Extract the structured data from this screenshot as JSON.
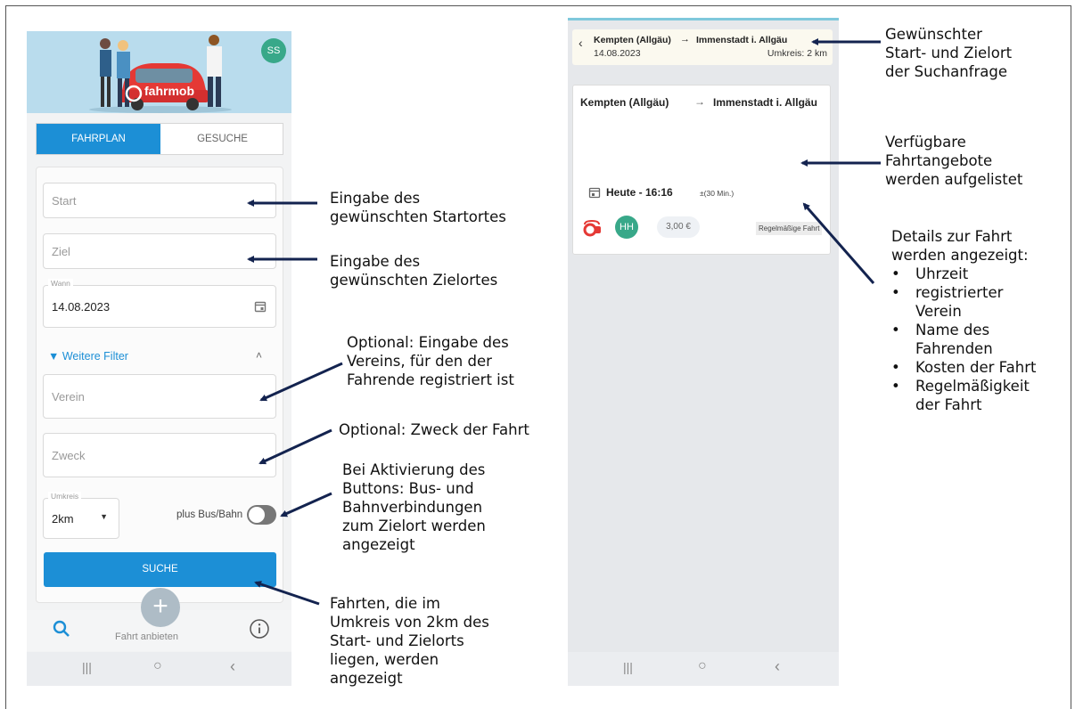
{
  "left_phone": {
    "avatar": "SS",
    "logo": "fahrmob",
    "tabs": {
      "fahrplan": "FAHRPLAN",
      "gesuche": "GESUCHE"
    },
    "form": {
      "start_placeholder": "Start",
      "ziel_placeholder": "Ziel",
      "wann_label": "Wann",
      "wann_value": "14.08.2023",
      "filter_label": "Weitere Filter",
      "verein_placeholder": "Verein",
      "zweck_placeholder": "Zweck",
      "umkreis_label": "Umkreis",
      "umkreis_value": "2km",
      "bus_bahn_label": "plus Bus/Bahn",
      "search_button": "SUCHE"
    },
    "bottom_nav": {
      "offer_label": "Fahrt anbieten"
    }
  },
  "right_phone": {
    "header": {
      "from": "Kempten (Allgäu)",
      "arrow": "→",
      "to": "Immenstadt i. Allgäu",
      "date": "14.08.2023",
      "radius": "Umkreis: 2 km"
    },
    "result": {
      "from": "Kempten (Allgäu)",
      "arrow": "→",
      "to": "Immenstadt i. Allgäu",
      "time": "Heute - 16:16",
      "tolerance": "±(30 Min.)",
      "driver_initials": "HH",
      "price": "3,00 €",
      "frequency": "Regelmäßige Fahrt"
    }
  },
  "annotations": {
    "start": [
      "Eingabe des",
      "gewünschten Startortes"
    ],
    "ziel": [
      "Eingabe des",
      "gewünschten Zielortes"
    ],
    "verein": [
      "Optional: Eingabe des",
      "Vereins, für den der",
      "Fahrende registriert ist"
    ],
    "zweck": "Optional: Zweck der Fahrt",
    "bus_bahn": [
      "Bei Aktivierung des",
      "Buttons: Bus- und",
      "Bahnverbindungen",
      "zum Zielort werden",
      "angezeigt"
    ],
    "suche": [
      "Fahrten, die im",
      "Umkreis von 2km des",
      "Start- und Zielorts",
      "liegen, werden",
      "angezeigt"
    ],
    "header": [
      "Gewünschter",
      "Start- und Zielort",
      "der Suchanfrage"
    ],
    "offers": [
      "Verfügbare",
      "Fahrtangebote",
      "werden aufgelistet"
    ],
    "details_title": [
      "Details zur Fahrt",
      "werden angezeigt:"
    ],
    "details_items": [
      "Uhrzeit",
      "registrierter Verein",
      "Name des Fahrenden",
      "Kosten der Fahrt",
      "Regelmäßigkeit der Fahrt"
    ]
  },
  "colors": {
    "primary": "#1c8fd6",
    "green": "#38a889",
    "hero": "#b9dced",
    "arrow": "#13234f",
    "brand_red": "#e53935"
  }
}
